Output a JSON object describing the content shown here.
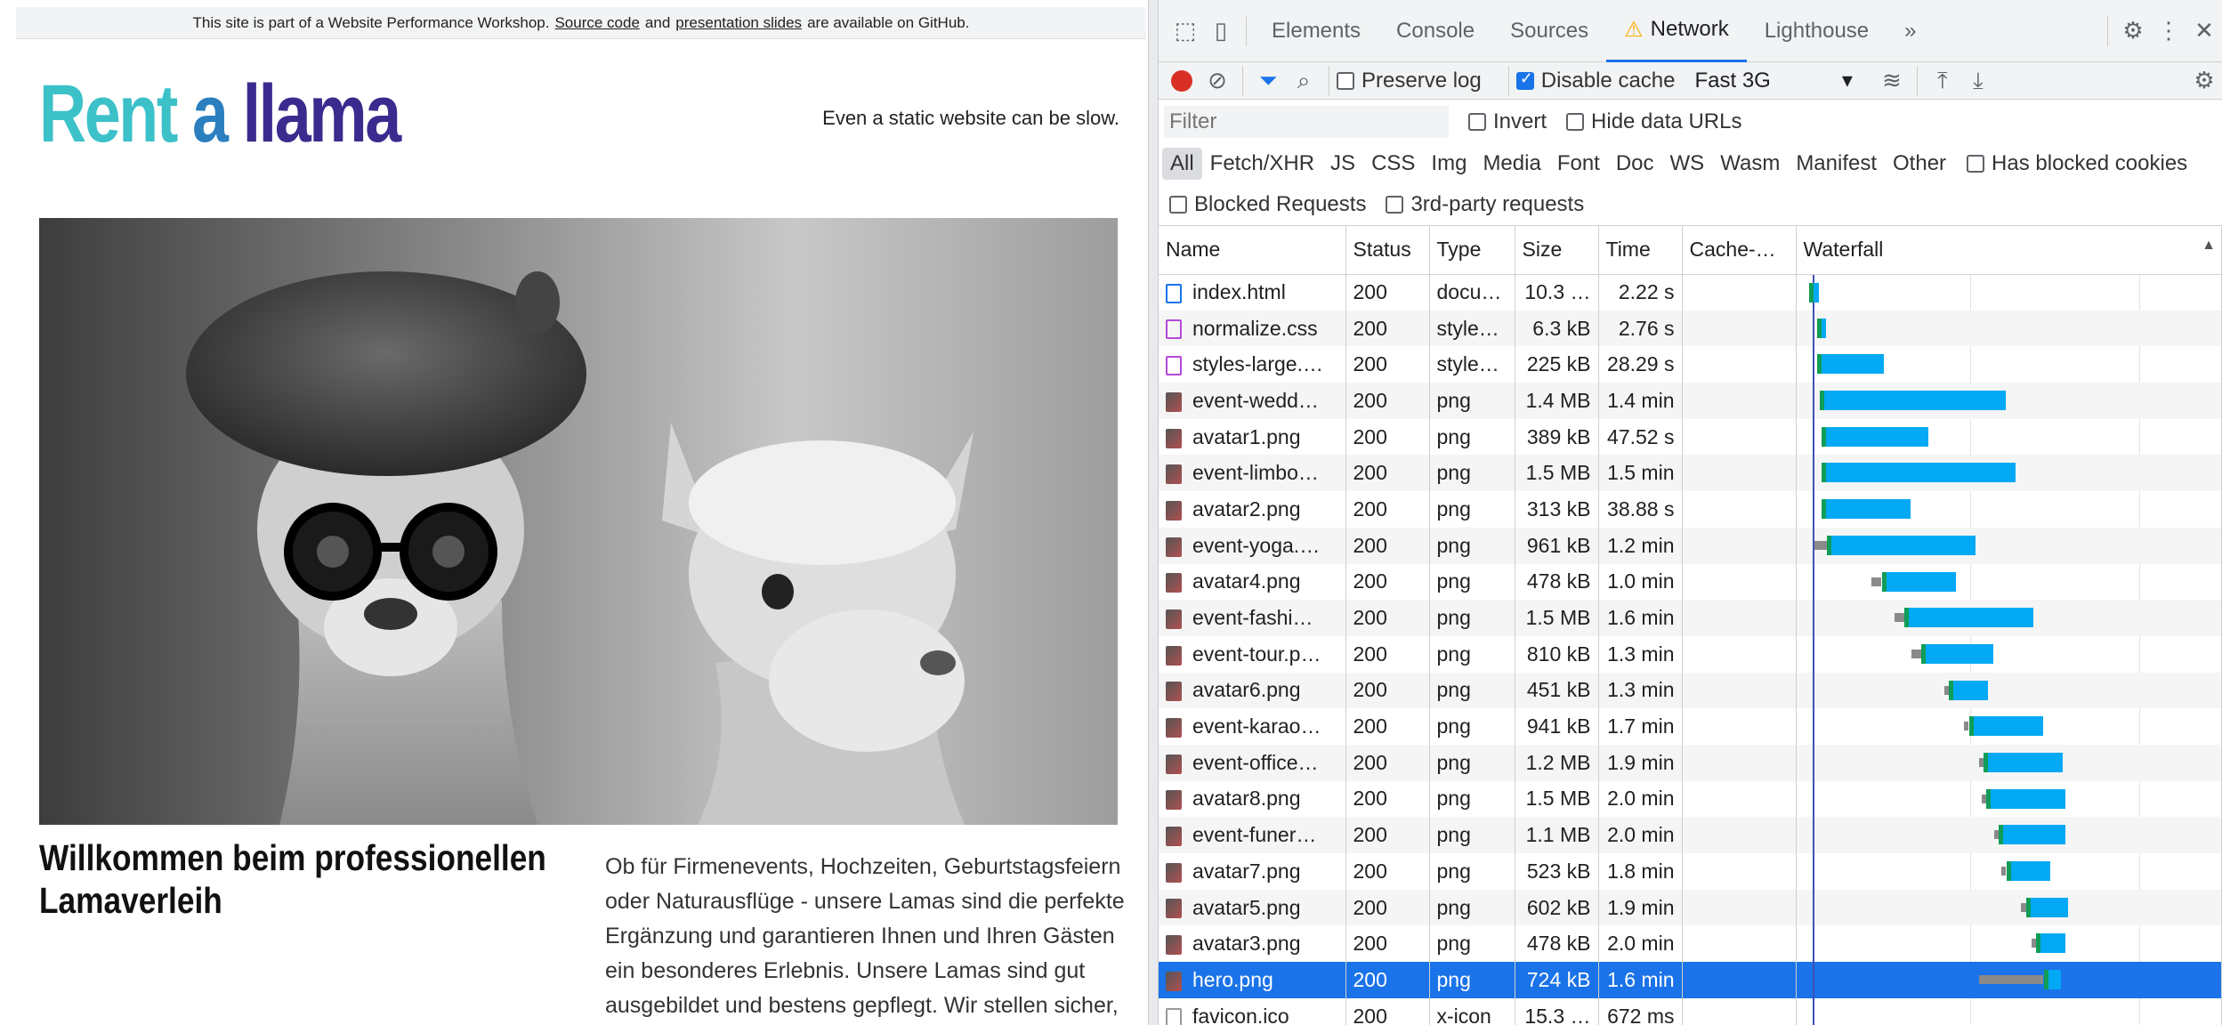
{
  "site": {
    "banner_before": "This site is part of a Website Performance Workshop.",
    "banner_link1": "Source code",
    "banner_and": "and",
    "banner_link2": "presentation slides",
    "banner_after": "are available on GitHub.",
    "logo_w1": "Rent",
    "logo_w2": "a",
    "logo_w3": "llama",
    "tagline": "Even a static website can be slow.",
    "welcome_heading": "Willkommen beim professionellen Lamaverleih",
    "intro_text": "Ob für Firmenevents, Hochzeiten, Geburtstagsfeiern oder Naturausflüge - unsere Lamas sind die perfekte Ergänzung und garantieren Ihnen und Ihren Gästen ein besonderes Erlebnis. Unsere Lamas sind gut ausgebildet und bestens gepflegt. Wir stellen sicher,"
  },
  "devtools": {
    "tabs": [
      "Elements",
      "Console",
      "Sources",
      "Network",
      "Lighthouse"
    ],
    "active_tab": "Network",
    "more_tabs": "»",
    "preserve_log": "Preserve log",
    "disable_cache": "Disable cache",
    "throttle": "Fast 3G",
    "filter_placeholder": "Filter",
    "invert": "Invert",
    "hide_data_urls": "Hide data URLs",
    "types": [
      "All",
      "Fetch/XHR",
      "JS",
      "CSS",
      "Img",
      "Media",
      "Font",
      "Doc",
      "WS",
      "Wasm",
      "Manifest",
      "Other"
    ],
    "has_blocked_cookies": "Has blocked cookies",
    "blocked_requests": "Blocked Requests",
    "third_party": "3rd-party requests",
    "columns": [
      "Name",
      "Status",
      "Type",
      "Size",
      "Time",
      "Cache-…",
      "Waterfall"
    ],
    "sort_arrow": "▲",
    "rows": [
      {
        "name": "index.html",
        "status": "200",
        "type": "docu…",
        "size": "10.3 …",
        "time": "2.22 s",
        "icon": "doc",
        "wait": 0.0,
        "start": 0.01,
        "dl": 0.02
      },
      {
        "name": "normalize.css",
        "status": "200",
        "type": "style…",
        "size": "6.3 kB",
        "time": "2.76 s",
        "icon": "css",
        "wait": 0.0,
        "start": 0.04,
        "dl": 0.02
      },
      {
        "name": "styles-large.…",
        "status": "200",
        "type": "style…",
        "size": "225 kB",
        "time": "28.29 s",
        "icon": "css",
        "wait": 0.0,
        "start": 0.04,
        "dl": 0.25
      },
      {
        "name": "event-wedd…",
        "status": "200",
        "type": "png",
        "size": "1.4 MB",
        "time": "1.4 min",
        "icon": "png",
        "wait": 0.0,
        "start": 0.05,
        "dl": 0.73
      },
      {
        "name": "avatar1.png",
        "status": "200",
        "type": "png",
        "size": "389 kB",
        "time": "47.52 s",
        "icon": "png",
        "wait": 0.0,
        "start": 0.06,
        "dl": 0.41
      },
      {
        "name": "event-limbo…",
        "status": "200",
        "type": "png",
        "size": "1.5 MB",
        "time": "1.5 min",
        "icon": "png",
        "wait": 0.0,
        "start": 0.06,
        "dl": 0.76
      },
      {
        "name": "avatar2.png",
        "status": "200",
        "type": "png",
        "size": "313 kB",
        "time": "38.88 s",
        "icon": "png",
        "wait": 0.0,
        "start": 0.06,
        "dl": 0.34
      },
      {
        "name": "event-yoga.…",
        "status": "200",
        "type": "png",
        "size": "961 kB",
        "time": "1.2 min",
        "icon": "png",
        "wait": 0.03,
        "start": 0.08,
        "dl": 0.58
      },
      {
        "name": "avatar4.png",
        "status": "200",
        "type": "png",
        "size": "478 kB",
        "time": "1.0 min",
        "icon": "png",
        "wait": 0.26,
        "start": 0.3,
        "dl": 0.28
      },
      {
        "name": "event-fashi…",
        "status": "200",
        "type": "png",
        "size": "1.5 MB",
        "time": "1.6 min",
        "icon": "png",
        "wait": 0.35,
        "start": 0.39,
        "dl": 0.5
      },
      {
        "name": "event-tour.p…",
        "status": "200",
        "type": "png",
        "size": "810 kB",
        "time": "1.3 min",
        "icon": "png",
        "wait": 0.42,
        "start": 0.46,
        "dl": 0.27
      },
      {
        "name": "avatar6.png",
        "status": "200",
        "type": "png",
        "size": "451 kB",
        "time": "1.3 min",
        "icon": "png",
        "wait": 0.55,
        "start": 0.57,
        "dl": 0.14
      },
      {
        "name": "event-karao…",
        "status": "200",
        "type": "png",
        "size": "941 kB",
        "time": "1.7 min",
        "icon": "png",
        "wait": 0.63,
        "start": 0.65,
        "dl": 0.28
      },
      {
        "name": "event-office…",
        "status": "200",
        "type": "png",
        "size": "1.2 MB",
        "time": "1.9 min",
        "icon": "png",
        "wait": 0.69,
        "start": 0.71,
        "dl": 0.3
      },
      {
        "name": "avatar8.png",
        "status": "200",
        "type": "png",
        "size": "1.5 MB",
        "time": "2.0 min",
        "icon": "png",
        "wait": 0.7,
        "start": 0.72,
        "dl": 0.3
      },
      {
        "name": "event-funer…",
        "status": "200",
        "type": "png",
        "size": "1.1 MB",
        "time": "2.0 min",
        "icon": "png",
        "wait": 0.75,
        "start": 0.77,
        "dl": 0.25
      },
      {
        "name": "avatar7.png",
        "status": "200",
        "type": "png",
        "size": "523 kB",
        "time": "1.8 min",
        "icon": "png",
        "wait": 0.78,
        "start": 0.8,
        "dl": 0.16
      },
      {
        "name": "avatar5.png",
        "status": "200",
        "type": "png",
        "size": "602 kB",
        "time": "1.9 min",
        "icon": "png",
        "wait": 0.86,
        "start": 0.88,
        "dl": 0.15
      },
      {
        "name": "avatar3.png",
        "status": "200",
        "type": "png",
        "size": "478 kB",
        "time": "2.0 min",
        "icon": "png",
        "wait": 0.9,
        "start": 0.92,
        "dl": 0.1
      },
      {
        "name": "hero.png",
        "status": "200",
        "type": "png",
        "size": "724 kB",
        "time": "1.6 min",
        "icon": "png",
        "wait": 0.69,
        "start": 0.95,
        "dl": 0.05
      },
      {
        "name": "favicon.ico",
        "status": "200",
        "type": "x-icon",
        "size": "15.3 …",
        "time": "672 ms",
        "icon": "ico2",
        "wait": 0.0,
        "start": 0.0,
        "dl": 0.0
      }
    ],
    "selected_row": "hero.png"
  },
  "colors": {
    "accent": "#1a73e8",
    "record": "#d93025",
    "download": "#03a9f4",
    "connect": "#0f9d58"
  }
}
